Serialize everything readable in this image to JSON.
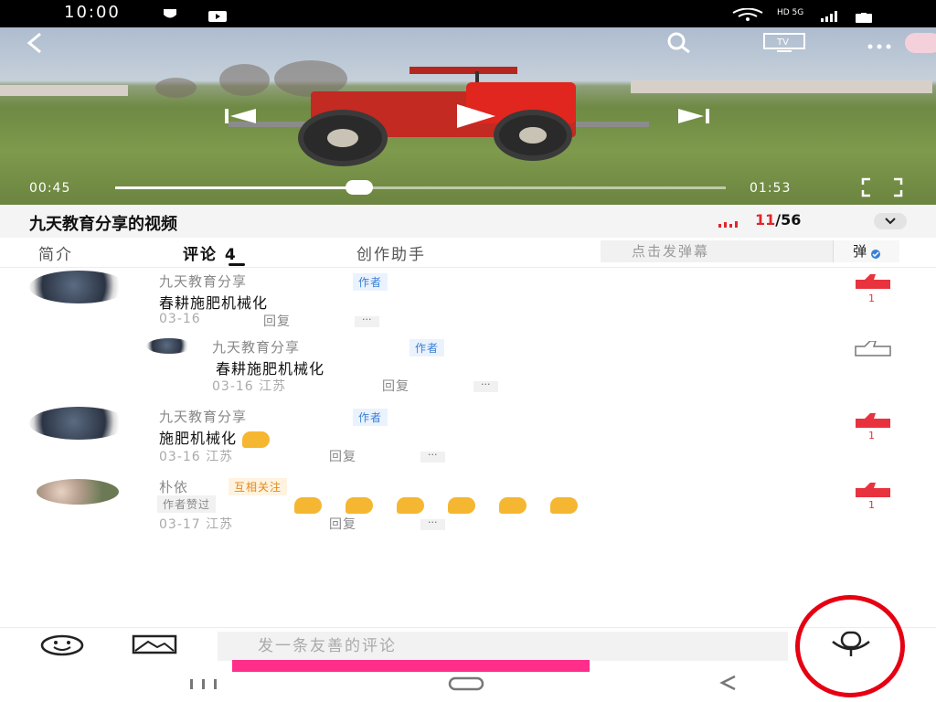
{
  "status_bar": {
    "time": "10:00",
    "network": "HD 5G"
  },
  "video": {
    "current_time": "00:45",
    "duration": "01:53",
    "progress": 0.4
  },
  "title_row": {
    "title": "九天教育分享的视频",
    "episode_current": "11",
    "episode_total": "/56"
  },
  "tabs": [
    {
      "label": "简介"
    },
    {
      "label": "评论 4"
    },
    {
      "label": "创作助手"
    }
  ],
  "danmaku": {
    "placeholder": "点击发弹幕",
    "button": "弹"
  },
  "comments": [
    {
      "user": "九天教育分享",
      "tag": "作者",
      "text": "春耕施肥机械化",
      "date": "03-16",
      "reply": "回复",
      "more": "···",
      "likes": "1"
    },
    {
      "user": "九天教育分享",
      "tag": "作者",
      "text": "春耕施肥机械化",
      "date": "03-16 江苏",
      "reply": "回复",
      "more": "···"
    },
    {
      "user": "九天教育分享",
      "tag": "作者",
      "text": "施肥机械化",
      "date": "03-16 江苏",
      "reply": "回复",
      "more": "···",
      "likes": "1"
    },
    {
      "user": "朴依",
      "tag": "互相关注",
      "liked_tag": "作者赞过",
      "date": "03-17 江苏",
      "reply": "回复",
      "more": "···",
      "likes": "1"
    }
  ],
  "bottom": {
    "comment_placeholder": "发一条友善的评论"
  },
  "icons": {
    "back": "back-arrow-icon",
    "search": "search-icon",
    "tv": "tv-cast-icon",
    "more": "more-dots-icon",
    "prev": "skip-previous-icon",
    "play": "play-icon",
    "next": "skip-next-icon",
    "fullscreen": "fullscreen-icon",
    "like": "thumbs-up-icon",
    "emoji": "emoji-icon",
    "image": "image-icon",
    "mic": "microphone-icon"
  },
  "colors": {
    "accent_red": "#e8333f",
    "author_blue": "#3a7fd5",
    "follow_orange": "#e08b1a",
    "highlight_pink": "#ff2e8b",
    "annotation_red": "#e60012"
  }
}
